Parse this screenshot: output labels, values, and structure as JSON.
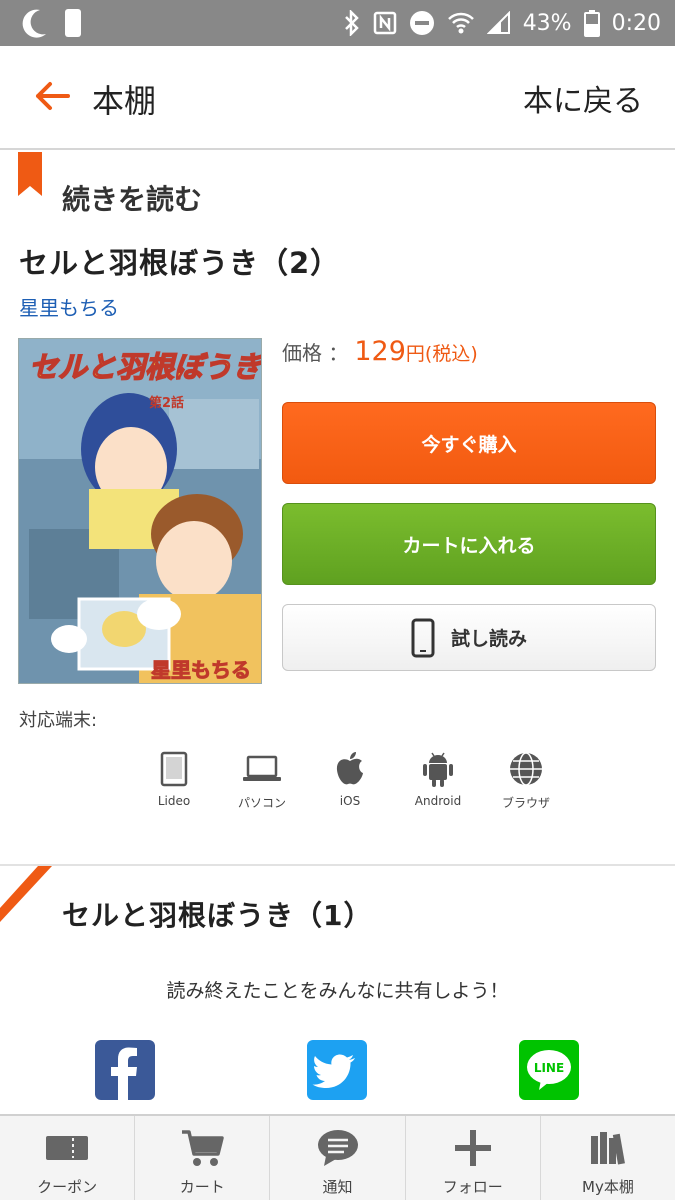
{
  "status_bar": {
    "battery": "43%",
    "time": "0:20"
  },
  "header": {
    "title": "本棚",
    "return_label": "本に戻る"
  },
  "continue_section": {
    "heading": "続きを読む",
    "book_title": "セルと羽根ぼうき（2）",
    "author": "星里もちる",
    "cover": {
      "title_text": "セルと羽根ぼうき",
      "episode_text": "第2話",
      "author_text": "星里もちる"
    },
    "price_label": "価格 ：",
    "price_value": "129",
    "price_unit": "円(税込)",
    "buy_label": "今すぐ購入",
    "cart_label": "カートに入れる",
    "trial_label": "試し読み",
    "devices_label": "対応端末:",
    "devices": [
      {
        "label": "Lideo",
        "icon": "tablet-icon"
      },
      {
        "label": "パソコン",
        "icon": "laptop-icon"
      },
      {
        "label": "iOS",
        "icon": "apple-icon"
      },
      {
        "label": "Android",
        "icon": "android-icon"
      },
      {
        "label": "ブラウザ",
        "icon": "globe-icon"
      }
    ]
  },
  "previous_section": {
    "book_title": "セルと羽根ぼうき（1）",
    "share_text": "読み終えたことをみんなに共有しよう！",
    "share_line_text": "LINE"
  },
  "bottom_nav": [
    {
      "label": "クーポン",
      "icon": "coupon-icon"
    },
    {
      "label": "カート",
      "icon": "cart-icon"
    },
    {
      "label": "通知",
      "icon": "notification-icon"
    },
    {
      "label": "フォロー",
      "icon": "plus-icon"
    },
    {
      "label": "My本棚",
      "icon": "bookshelf-icon"
    }
  ],
  "colors": {
    "accent_orange": "#ef5a14",
    "green": "#6aac24",
    "link_blue": "#1e5fb4",
    "status_bar": "#888888"
  }
}
